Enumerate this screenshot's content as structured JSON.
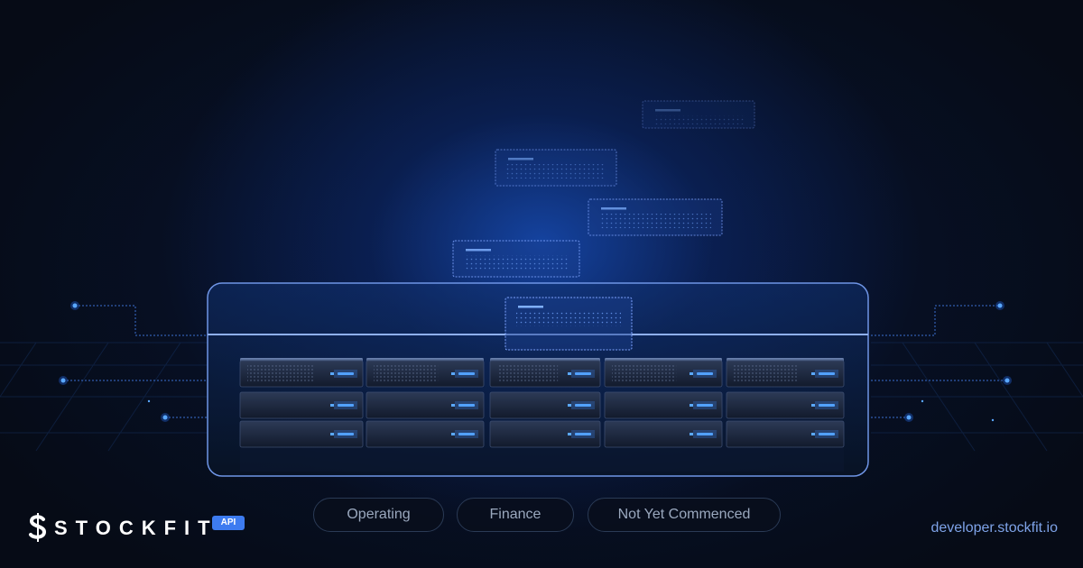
{
  "brand": {
    "name": "STOCKFIT",
    "badge": "API",
    "logo_icon": "dollar-s-icon"
  },
  "categories": [
    {
      "label": "Operating"
    },
    {
      "label": "Finance"
    },
    {
      "label": "Not Yet Commenced"
    }
  ],
  "footer": {
    "url": "developer.stockfit.io"
  },
  "colors": {
    "background": "#060b16",
    "glow": "#1850be",
    "accent": "#3d7bf0",
    "frame_line": "#6f95e6",
    "led": "#5aa8ff",
    "pill_text": "#9aa8be",
    "url_text": "#7ea3e8"
  }
}
